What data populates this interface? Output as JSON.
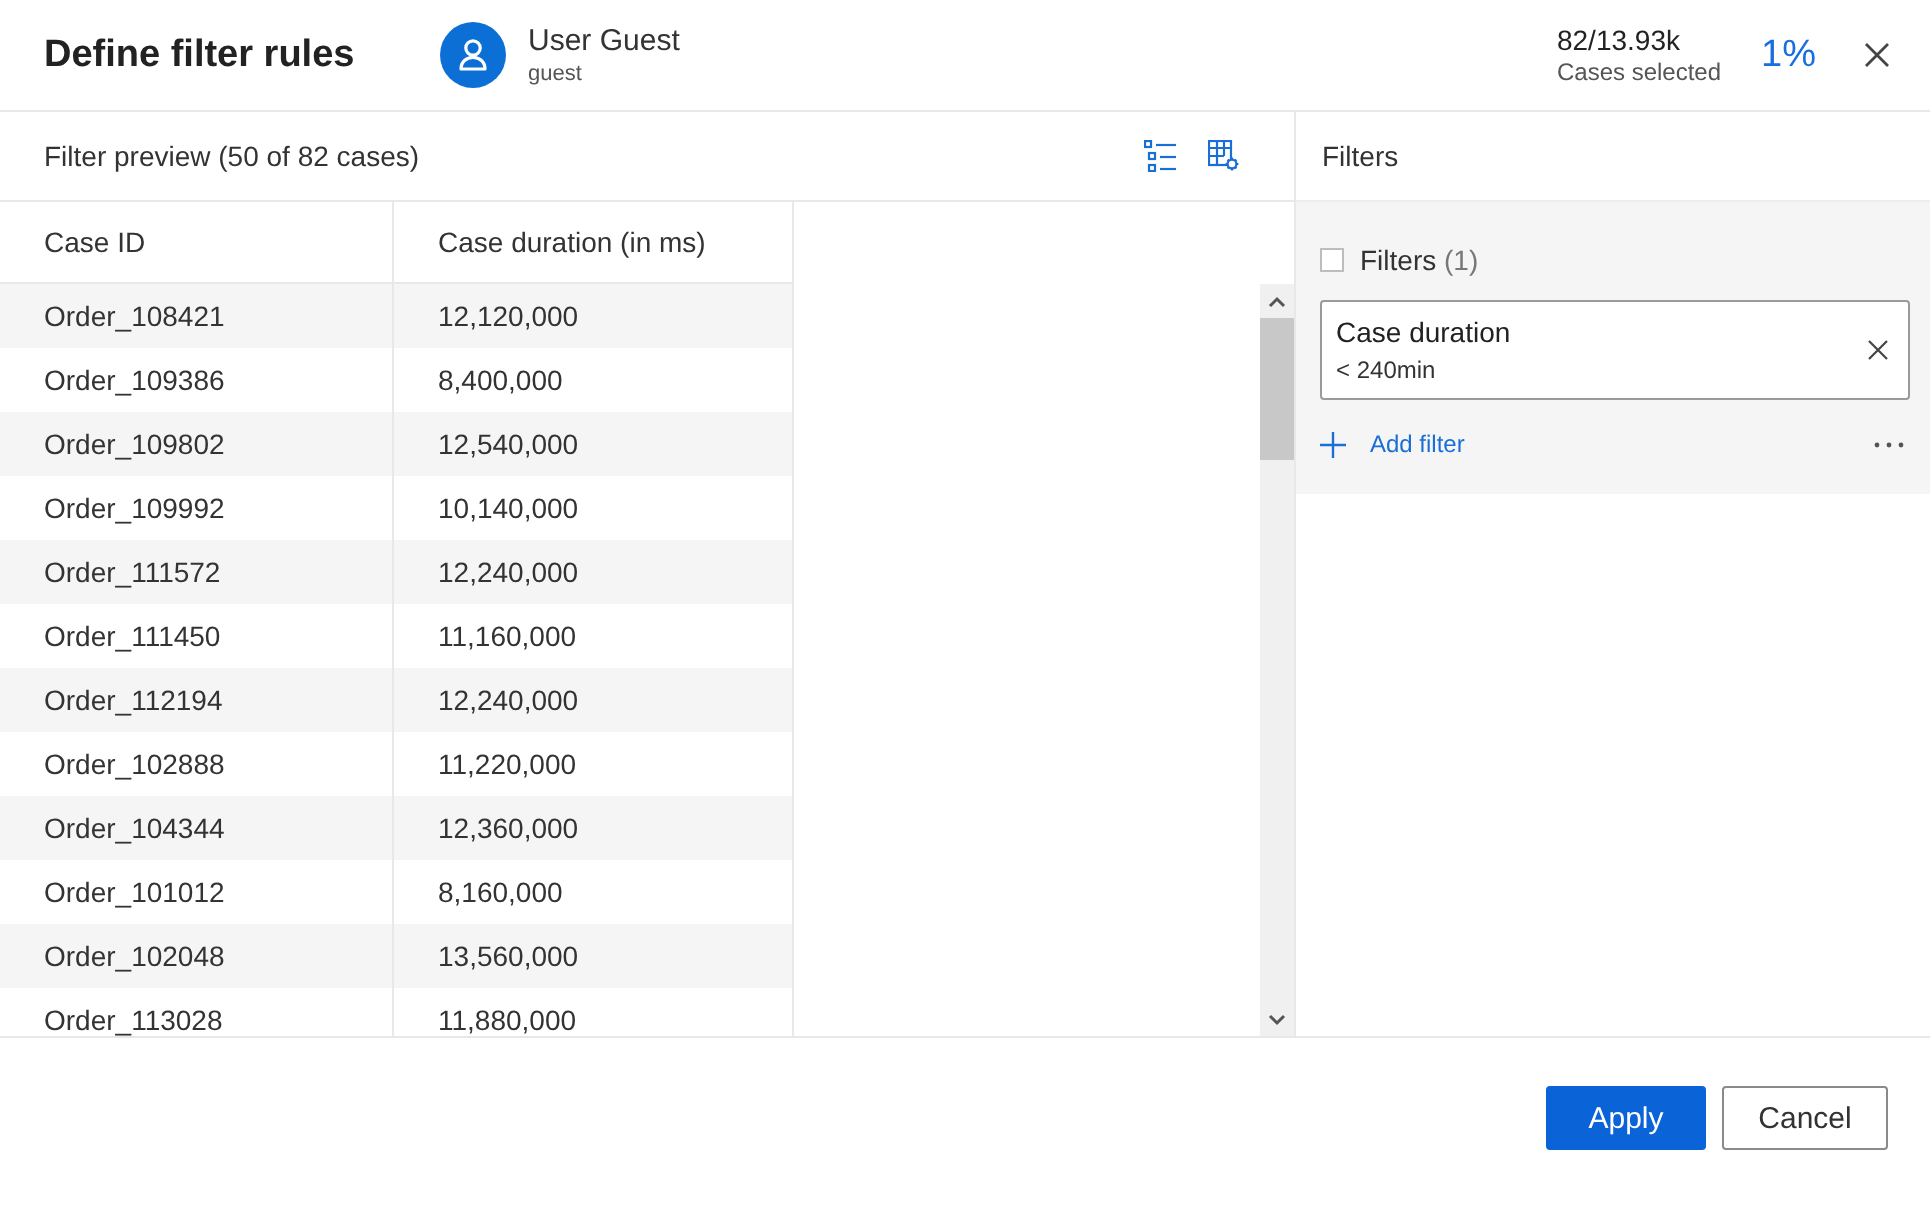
{
  "header": {
    "title": "Define filter rules",
    "user": {
      "name": "User Guest",
      "role": "guest"
    },
    "cases": {
      "count": "82/13.93k",
      "label": "Cases selected"
    },
    "percent": "1%"
  },
  "preview": {
    "title": "Filter preview (50 of 82 cases)",
    "table": {
      "columns": [
        "Case ID",
        "Case duration (in ms)"
      ],
      "rows": [
        [
          "Order_108421",
          "12,120,000"
        ],
        [
          "Order_109386",
          "8,400,000"
        ],
        [
          "Order_109802",
          "12,540,000"
        ],
        [
          "Order_109992",
          "10,140,000"
        ],
        [
          "Order_111572",
          "12,240,000"
        ],
        [
          "Order_111450",
          "11,160,000"
        ],
        [
          "Order_112194",
          "12,240,000"
        ],
        [
          "Order_102888",
          "11,220,000"
        ],
        [
          "Order_104344",
          "12,360,000"
        ],
        [
          "Order_101012",
          "8,160,000"
        ],
        [
          "Order_102048",
          "13,560,000"
        ],
        [
          "Order_113028",
          "11,880,000"
        ]
      ]
    }
  },
  "filters_panel": {
    "title": "Filters",
    "group": {
      "label": "Filters",
      "count": "(1)",
      "checked": false
    },
    "filters": [
      {
        "name": "Case duration",
        "condition": "< 240min"
      }
    ],
    "add_label": "Add filter"
  },
  "buttons": [
    {
      "label": "Apply",
      "kind": "primary"
    },
    {
      "label": "Cancel",
      "kind": "secondary"
    }
  ]
}
